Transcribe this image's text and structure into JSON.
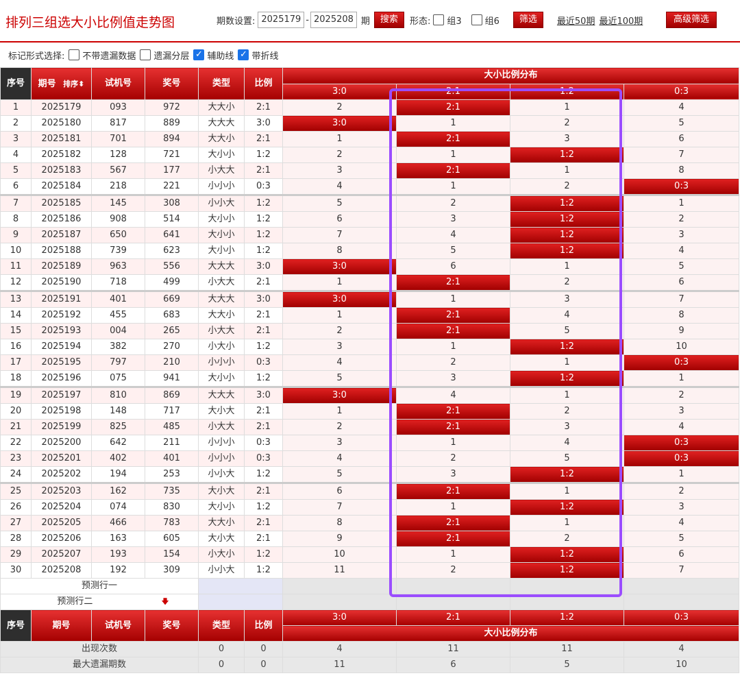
{
  "header": {
    "title": "排列三组选大小比例值走势图",
    "period_label": "期数设置:",
    "period_from": "2025179",
    "dash": "-",
    "period_to": "2025208",
    "period_unit": "期",
    "search_button": "搜索",
    "form_label": "形态:",
    "group3_label": "组3",
    "group6_label": "组6",
    "filter_button": "筛选",
    "recent50": "最近50期",
    "recent100": "最近100期",
    "advanced_button": "高级筛选"
  },
  "marks": {
    "label": "标记形式选择:",
    "options": [
      {
        "label": "不带遗漏数据",
        "checked": false
      },
      {
        "label": "遗漏分层",
        "checked": false
      },
      {
        "label": "辅助线",
        "checked": true
      },
      {
        "label": "带折线",
        "checked": true
      }
    ]
  },
  "table": {
    "headers": {
      "seq": "序号",
      "issue": "期号",
      "sort": "排序",
      "trial": "试机号",
      "prize": "奖号",
      "type": "类型",
      "ratio": "比例",
      "group": "大小比例分布"
    },
    "ratio_cols": [
      "3:0",
      "2:1",
      "1:2",
      "0:3"
    ],
    "rows": [
      {
        "seq": "1",
        "issue": "2025179",
        "trial": "093",
        "prize": "972",
        "type": "大大小",
        "ratio": "2:1",
        "dist": [
          "2",
          "2:1",
          "1",
          "4"
        ]
      },
      {
        "seq": "2",
        "issue": "2025180",
        "trial": "817",
        "prize": "889",
        "type": "大大大",
        "ratio": "3:0",
        "dist": [
          "3:0",
          "1",
          "2",
          "5"
        ]
      },
      {
        "seq": "3",
        "issue": "2025181",
        "trial": "701",
        "prize": "894",
        "type": "大大小",
        "ratio": "2:1",
        "dist": [
          "1",
          "2:1",
          "3",
          "6"
        ]
      },
      {
        "seq": "4",
        "issue": "2025182",
        "trial": "128",
        "prize": "721",
        "type": "大小小",
        "ratio": "1:2",
        "dist": [
          "2",
          "1",
          "1:2",
          "7"
        ]
      },
      {
        "seq": "5",
        "issue": "2025183",
        "trial": "567",
        "prize": "177",
        "type": "小大大",
        "ratio": "2:1",
        "dist": [
          "3",
          "2:1",
          "1",
          "8"
        ]
      },
      {
        "seq": "6",
        "issue": "2025184",
        "trial": "218",
        "prize": "221",
        "type": "小小小",
        "ratio": "0:3",
        "dist": [
          "4",
          "1",
          "2",
          "0:3"
        ]
      },
      {
        "seq": "7",
        "issue": "2025185",
        "trial": "145",
        "prize": "308",
        "type": "小小大",
        "ratio": "1:2",
        "dist": [
          "5",
          "2",
          "1:2",
          "1"
        ]
      },
      {
        "seq": "8",
        "issue": "2025186",
        "trial": "908",
        "prize": "514",
        "type": "大小小",
        "ratio": "1:2",
        "dist": [
          "6",
          "3",
          "1:2",
          "2"
        ]
      },
      {
        "seq": "9",
        "issue": "2025187",
        "trial": "650",
        "prize": "641",
        "type": "大小小",
        "ratio": "1:2",
        "dist": [
          "7",
          "4",
          "1:2",
          "3"
        ]
      },
      {
        "seq": "10",
        "issue": "2025188",
        "trial": "739",
        "prize": "623",
        "type": "大小小",
        "ratio": "1:2",
        "dist": [
          "8",
          "5",
          "1:2",
          "4"
        ]
      },
      {
        "seq": "11",
        "issue": "2025189",
        "trial": "963",
        "prize": "556",
        "type": "大大大",
        "ratio": "3:0",
        "dist": [
          "3:0",
          "6",
          "1",
          "5"
        ]
      },
      {
        "seq": "12",
        "issue": "2025190",
        "trial": "718",
        "prize": "499",
        "type": "小大大",
        "ratio": "2:1",
        "dist": [
          "1",
          "2:1",
          "2",
          "6"
        ]
      },
      {
        "seq": "13",
        "issue": "2025191",
        "trial": "401",
        "prize": "669",
        "type": "大大大",
        "ratio": "3:0",
        "dist": [
          "3:0",
          "1",
          "3",
          "7"
        ]
      },
      {
        "seq": "14",
        "issue": "2025192",
        "trial": "455",
        "prize": "683",
        "type": "大大小",
        "ratio": "2:1",
        "dist": [
          "1",
          "2:1",
          "4",
          "8"
        ]
      },
      {
        "seq": "15",
        "issue": "2025193",
        "trial": "004",
        "prize": "265",
        "type": "小大大",
        "ratio": "2:1",
        "dist": [
          "2",
          "2:1",
          "5",
          "9"
        ]
      },
      {
        "seq": "16",
        "issue": "2025194",
        "trial": "382",
        "prize": "270",
        "type": "小大小",
        "ratio": "1:2",
        "dist": [
          "3",
          "1",
          "1:2",
          "10"
        ]
      },
      {
        "seq": "17",
        "issue": "2025195",
        "trial": "797",
        "prize": "210",
        "type": "小小小",
        "ratio": "0:3",
        "dist": [
          "4",
          "2",
          "1",
          "0:3"
        ]
      },
      {
        "seq": "18",
        "issue": "2025196",
        "trial": "075",
        "prize": "941",
        "type": "大小小",
        "ratio": "1:2",
        "dist": [
          "5",
          "3",
          "1:2",
          "1"
        ]
      },
      {
        "seq": "19",
        "issue": "2025197",
        "trial": "810",
        "prize": "869",
        "type": "大大大",
        "ratio": "3:0",
        "dist": [
          "3:0",
          "4",
          "1",
          "2"
        ]
      },
      {
        "seq": "20",
        "issue": "2025198",
        "trial": "148",
        "prize": "717",
        "type": "大小大",
        "ratio": "2:1",
        "dist": [
          "1",
          "2:1",
          "2",
          "3"
        ]
      },
      {
        "seq": "21",
        "issue": "2025199",
        "trial": "825",
        "prize": "485",
        "type": "小大大",
        "ratio": "2:1",
        "dist": [
          "2",
          "2:1",
          "3",
          "4"
        ]
      },
      {
        "seq": "22",
        "issue": "2025200",
        "trial": "642",
        "prize": "211",
        "type": "小小小",
        "ratio": "0:3",
        "dist": [
          "3",
          "1",
          "4",
          "0:3"
        ]
      },
      {
        "seq": "23",
        "issue": "2025201",
        "trial": "402",
        "prize": "401",
        "type": "小小小",
        "ratio": "0:3",
        "dist": [
          "4",
          "2",
          "5",
          "0:3"
        ]
      },
      {
        "seq": "24",
        "issue": "2025202",
        "trial": "194",
        "prize": "253",
        "type": "小小大",
        "ratio": "1:2",
        "dist": [
          "5",
          "3",
          "1:2",
          "1"
        ]
      },
      {
        "seq": "25",
        "issue": "2025203",
        "trial": "162",
        "prize": "735",
        "type": "大小大",
        "ratio": "2:1",
        "dist": [
          "6",
          "2:1",
          "1",
          "2"
        ]
      },
      {
        "seq": "26",
        "issue": "2025204",
        "trial": "074",
        "prize": "830",
        "type": "大小小",
        "ratio": "1:2",
        "dist": [
          "7",
          "1",
          "1:2",
          "3"
        ]
      },
      {
        "seq": "27",
        "issue": "2025205",
        "trial": "466",
        "prize": "783",
        "type": "大大小",
        "ratio": "2:1",
        "dist": [
          "8",
          "2:1",
          "1",
          "4"
        ]
      },
      {
        "seq": "28",
        "issue": "2025206",
        "trial": "163",
        "prize": "605",
        "type": "大小大",
        "ratio": "2:1",
        "dist": [
          "9",
          "2:1",
          "2",
          "5"
        ]
      },
      {
        "seq": "29",
        "issue": "2025207",
        "trial": "193",
        "prize": "154",
        "type": "小大小",
        "ratio": "1:2",
        "dist": [
          "10",
          "1",
          "1:2",
          "6"
        ]
      },
      {
        "seq": "30",
        "issue": "2025208",
        "trial": "192",
        "prize": "309",
        "type": "小小大",
        "ratio": "1:2",
        "dist": [
          "11",
          "2",
          "1:2",
          "7"
        ]
      }
    ],
    "predict1": "预测行一",
    "predict2": "预测行二",
    "predict_arrow": "🡇",
    "stats": [
      {
        "label": "出现次数",
        "type": "0",
        "ratio": "0",
        "vals": [
          "4",
          "11",
          "11",
          "4"
        ]
      },
      {
        "label": "最大遗漏期数",
        "type": "0",
        "ratio": "0",
        "vals": [
          "11",
          "6",
          "5",
          "10"
        ]
      }
    ]
  }
}
